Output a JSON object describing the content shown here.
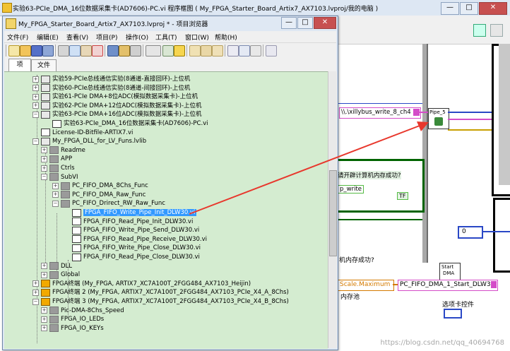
{
  "bg_window": {
    "title": "实验63-PCIe_DMA_16位数据采集卡(AD7606)-PC.vi 程序框图 ( My_FPGA_Starter_Board_Artix7_AX7103.lvproj/我的电脑 )",
    "min_label": "—",
    "max_label": "□",
    "close_label": "✕"
  },
  "diagram": {
    "path_const": "\\\\.\\xillybus_write_8_ch4",
    "pipe_label": "Pipe_5",
    "q_alloc": "请开辟计算机内存成功?",
    "p_write": "p_write",
    "tf_const": "TF",
    "num_zero": "0",
    "mem_q": "机内存成功?",
    "scale_const": "Scale.Maximum",
    "mem_pool": "内存池",
    "start_dma_line1": "Start",
    "start_dma_line2": "DMA",
    "fifo_ring": "PC_FIFO_DMA_1_Start_DLW30",
    "tab_ctrl": "选项卡控件",
    "watermark": "https://blog.csdn.net/qq_40694768"
  },
  "project": {
    "title": "My_FPGA_Starter_Board_Artix7_AX7103.lvproj * - 项目浏览器",
    "min_label": "—",
    "max_label": "□",
    "close_label": "✕",
    "menu": [
      "文件(F)",
      "编辑(E)",
      "查看(V)",
      "项目(P)",
      "操作(O)",
      "工具(T)",
      "窗口(W)",
      "帮助(H)"
    ],
    "tabs": [
      "项",
      "文件"
    ],
    "tree": [
      {
        "label": "实验59-PCIe总线通信实验(8通道-直接回环)-上位机",
        "icon": "lib-icon",
        "expander": "+"
      },
      {
        "label": "实验60-PCIe总线通信实验(8通道-间接回环)-上位机",
        "icon": "lib-icon",
        "expander": "+"
      },
      {
        "label": "实验61-PCIe DMA+8位ADC(模拟数据采集卡)-上位机",
        "icon": "lib-icon",
        "expander": "+"
      },
      {
        "label": "实验62-PCIe DMA+12位ADC(模拟数据采集卡)-上位机",
        "icon": "lib-icon",
        "expander": "+"
      },
      {
        "label": "实验63-PCIe DMA+16位ADC(模拟数据采集卡)-上位机",
        "icon": "lib-icon",
        "expander": "−"
      },
      {
        "label": "实验63-PCIe_DMA_16位数据采集卡(AD7606)-PC.vi",
        "icon": "vi-icon",
        "expander": ""
      },
      {
        "label": "License-ID-Bitfile-ARTIX7.vi",
        "icon": "vi-icon",
        "expander": ""
      },
      {
        "label": "My_FPGA_DLL_for_LV_Funs.lvlib",
        "icon": "lib-icon",
        "expander": "−"
      },
      {
        "label": "Readme",
        "icon": "folder-icon",
        "expander": "+"
      },
      {
        "label": "APP",
        "icon": "folder-icon",
        "expander": "+"
      },
      {
        "label": "Ctrls",
        "icon": "folder-icon",
        "expander": "+"
      },
      {
        "label": "SubVI",
        "icon": "folder-icon",
        "expander": "−"
      },
      {
        "label": "PC_FIFO_DMA_8Chs_Func",
        "icon": "folder-icon",
        "expander": "+"
      },
      {
        "label": "PC_FIFO_DMA_Raw_Func",
        "icon": "folder-icon",
        "expander": "+"
      },
      {
        "label": "PC_FIFO_Drirect_RW_Raw_Func",
        "icon": "folder-icon",
        "expander": "−"
      },
      {
        "label": "FPGA_FIFO_Write_Pipe_Init_DLW30.vi",
        "icon": "vi-icon",
        "expander": "",
        "selected": true
      },
      {
        "label": "FPGA_FIFO_Read_Pipe_Init_DLW30.vi",
        "icon": "vi-icon",
        "expander": ""
      },
      {
        "label": "FPGA_FIFO_Write_Pipe_Send_DLW30.vi",
        "icon": "vi-icon",
        "expander": ""
      },
      {
        "label": "FPGA_FIFO_Read_Pipe_Receive_DLW30.vi",
        "icon": "vi-icon",
        "expander": ""
      },
      {
        "label": "FPGA_FIFO_Write_Pipe_Close_DLW30.vi",
        "icon": "vi-icon",
        "expander": ""
      },
      {
        "label": "FPGA_FIFO_Read_Pipe_Close_DLW30.vi",
        "icon": "vi-icon",
        "expander": ""
      },
      {
        "label": "DLL",
        "icon": "folder-icon",
        "expander": "+"
      },
      {
        "label": "Global",
        "icon": "folder-icon",
        "expander": "+"
      },
      {
        "label": "FPGA终端 (My_FPGA, ARTIX7_XC7A100T_2FGG484_AX7103_Heijin)",
        "icon": "fpga-icon",
        "expander": "+"
      },
      {
        "label": "FPGA终端 2 (My_FPGA, ARTIX7_XC7A100T_2FGG484_AX7103_PCIe_X4_A_8Chs)",
        "icon": "fpga-icon",
        "expander": "+"
      },
      {
        "label": "FPGA终端 3 (My_FPGA, ARTIX7_XC7A100T_2FGG484_AX7103_PCIe_X4_B_8Chs)",
        "icon": "fpga-icon",
        "expander": "−"
      },
      {
        "label": "Pic-DMA-8Chs_Speed",
        "icon": "folder-icon",
        "expander": "+"
      },
      {
        "label": "FPGA_IO_LEDs",
        "icon": "folder-icon",
        "expander": "+"
      },
      {
        "label": "FPGA_IO_KEYs",
        "icon": "folder-icon",
        "expander": "+"
      }
    ]
  },
  "colors": {
    "selection": "#3399ff",
    "tree_bg": "#d4ecd0",
    "arrow": "#e8372c",
    "wire_blue": "#2a48c6",
    "wire_pink": "#d44cc8"
  }
}
